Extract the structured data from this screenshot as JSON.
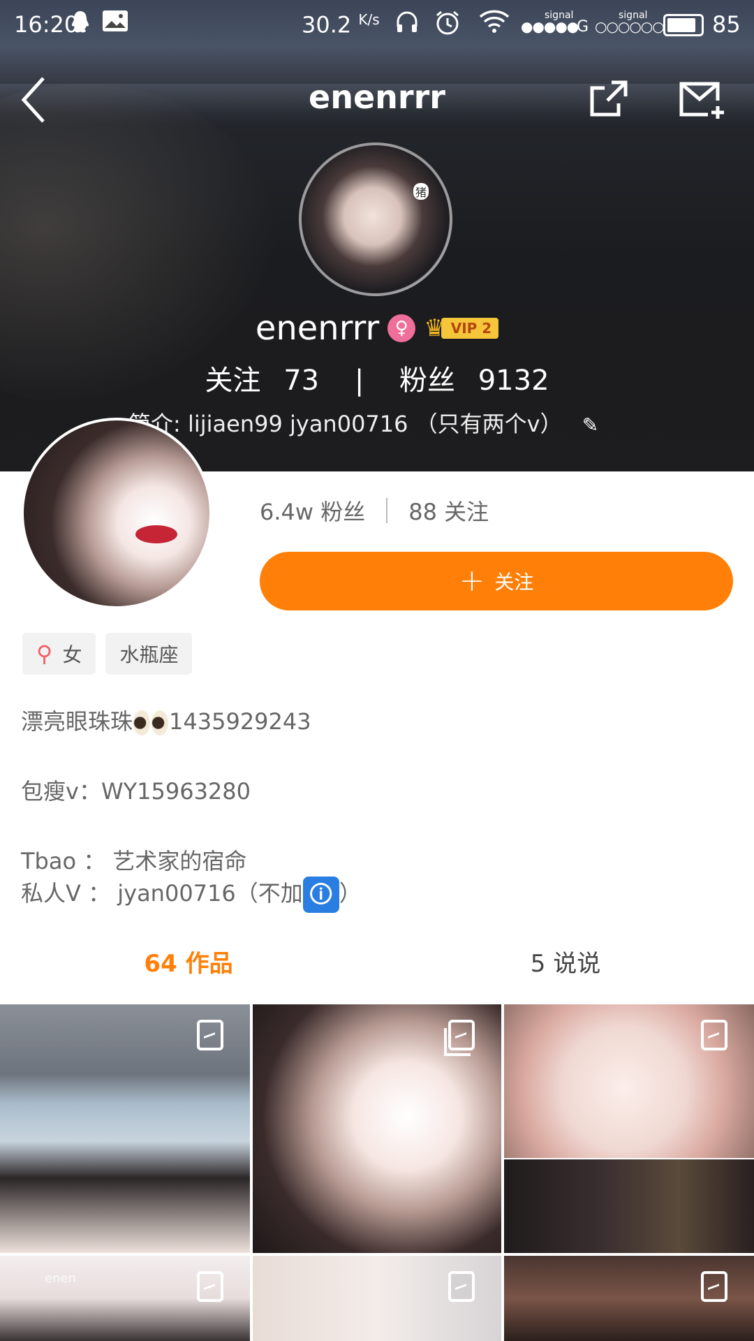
{
  "status_bar": {
    "time": "16:20",
    "speed": "30.2",
    "speed_unit": "K/s",
    "signal_label_1": "signal",
    "signal_label_2": "signal",
    "network_type": "G",
    "battery_level": "85"
  },
  "nav": {
    "title": "enenrrr"
  },
  "cover": {
    "avatar_tag": "猪",
    "name": "enenrrr",
    "vip_label": "VIP 2",
    "follow_label": "关注",
    "follow_count": "73",
    "separator": "|",
    "fans_label": "粉丝",
    "fans_count": "9132",
    "bio": "简介: lijiaen99   jyan00716 （只有两个v）"
  },
  "profile": {
    "fans_count": "6.4w",
    "fans_label": "粉丝",
    "follow_count": "88",
    "follow_label": "关注",
    "follow_button_label": "关注",
    "tags": [
      {
        "label": "女"
      },
      {
        "label": "水瓶座"
      }
    ],
    "bio_line1_text": "漂亮眼珠珠",
    "bio_line1_number": "1435929243",
    "bio_line2": "包瘦v：WY15963280",
    "bio_line3": "Tbao ： 艺术家的宿命",
    "bio_line4_text": "私人V ： jyan00716（不加",
    "bio_line4_close": "）"
  },
  "tabs": [
    {
      "count": "64",
      "label": "作品"
    },
    {
      "count": "5",
      "label": "说说"
    }
  ],
  "grid": {
    "watermark": "enen"
  },
  "colors": {
    "accent": "#ff7f08",
    "gender": "#f06e9a",
    "vip": "#f5c63a"
  }
}
